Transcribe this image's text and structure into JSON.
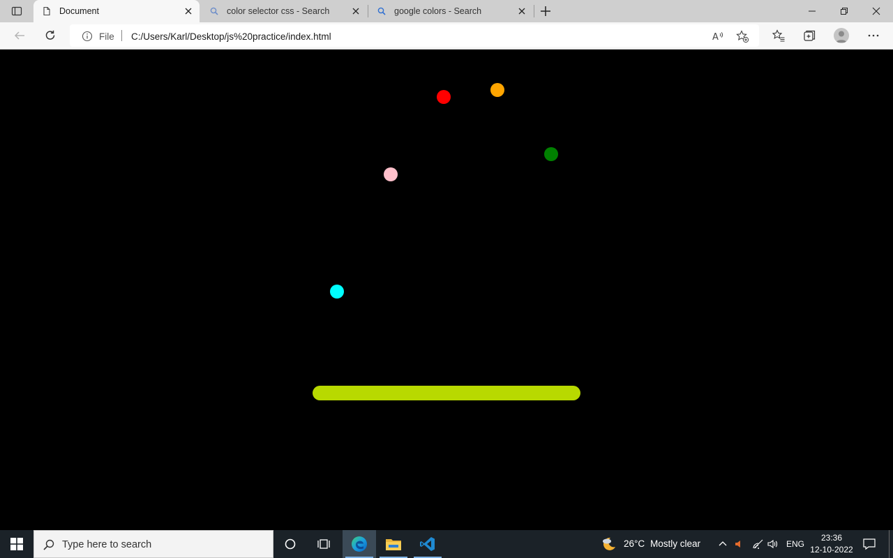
{
  "browser": {
    "tabs": [
      {
        "title": "Document",
        "active": true,
        "icon": "page-icon"
      },
      {
        "title": "color selector css - Search",
        "active": false,
        "icon": "search-icon"
      },
      {
        "title": "google colors - Search",
        "active": false,
        "icon": "search-icon"
      }
    ],
    "address": {
      "scheme_label": "File",
      "url": "C:/Users/Karl/Desktop/js%20practice/index.html"
    },
    "toolbar_icons": [
      "back-icon",
      "refresh-icon",
      "read-aloud-icon",
      "add-favorite-icon",
      "favorites-icon",
      "collections-icon",
      "profile-avatar",
      "more-icon"
    ],
    "window_controls": [
      "minimize-icon",
      "restore-icon",
      "close-icon"
    ]
  },
  "page": {
    "background": "#000000",
    "balls": [
      {
        "name": "red-ball",
        "color": "#ff0000"
      },
      {
        "name": "orange-ball",
        "color": "#ffa500"
      },
      {
        "name": "green-ball",
        "color": "#008000"
      },
      {
        "name": "pink-ball",
        "color": "#ffc0cb"
      },
      {
        "name": "cyan-ball",
        "color": "#00ffff"
      }
    ],
    "paddle": {
      "color": "#b8d900"
    }
  },
  "taskbar": {
    "search_placeholder": "Type here to search",
    "weather": {
      "temp": "26°C",
      "condition": "Mostly clear"
    },
    "language": "ENG",
    "time": "23:36",
    "date": "12-10-2022",
    "apps": [
      "cortana-icon",
      "task-view-icon",
      "edge-icon",
      "file-explorer-icon",
      "vscode-icon"
    ]
  }
}
